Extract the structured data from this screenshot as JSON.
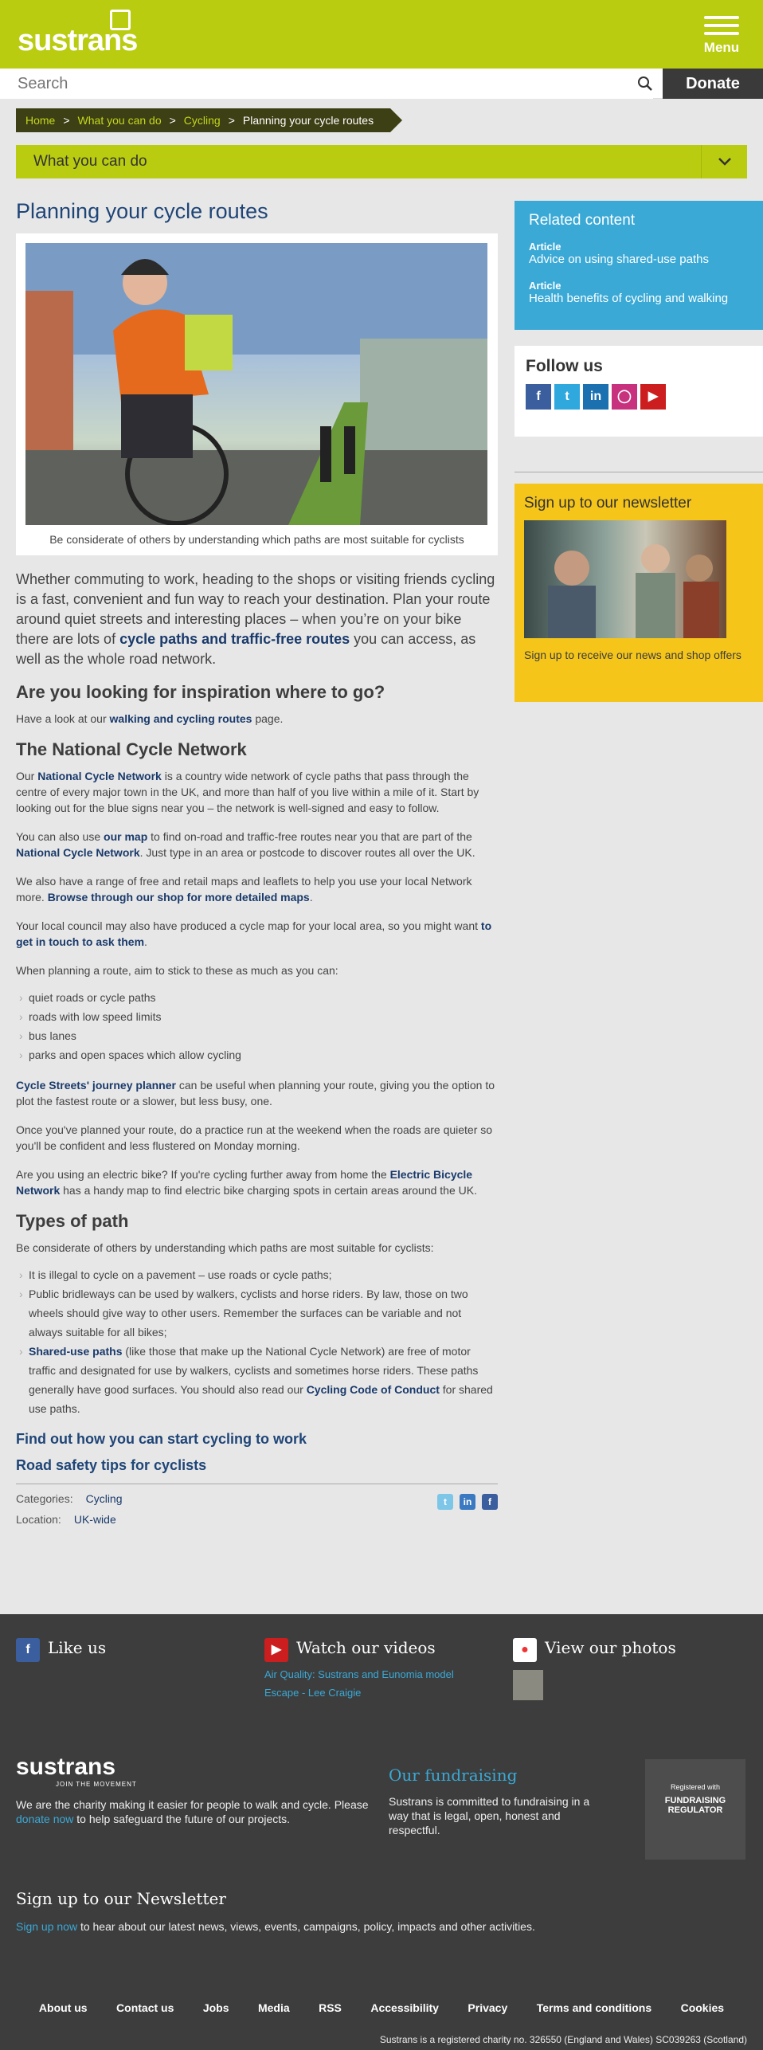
{
  "header": {
    "logo_text": "sustrans",
    "menu_label": "Menu",
    "search_placeholder": "Search",
    "donate_label": "Donate"
  },
  "breadcrumb": [
    "Home",
    "What you can do",
    "Cycling",
    "Planning your cycle routes"
  ],
  "section_nav": {
    "label": "What you can do"
  },
  "article": {
    "title": "Planning your cycle routes",
    "image_caption": "Be considerate of others by understanding which paths are most suitable for cyclists",
    "intro_pre": "Whether commuting to work, heading to the shops or visiting friends cycling is a fast, convenient and fun way to reach your destination. Plan your route around quiet streets and interesting places – when you’re on your bike there are lots of ",
    "intro_link": "cycle paths and traffic-free routes",
    "intro_post": " you can access, as well as the whole road network.",
    "inspiration_heading": "Are you looking for inspiration where to go?",
    "inspiration_pre": "Have a look at our ",
    "inspiration_link": "walking and cycling routes",
    "inspiration_post": " page.",
    "ncn_heading": "The National Cycle Network",
    "p1_pre": "Our ",
    "p1_link": "National Cycle Network",
    "p1_post": " is a country wide network of cycle paths that pass through the centre of every major town in the UK, and more than half of you live within a mile of it. Start by looking out for the blue signs near you – the network is well-signed and easy to follow.",
    "p2_pre": "You can also use ",
    "p2_link1": "our map",
    "p2_mid": " to find on-road and traffic-free routes near you that are part of the ",
    "p2_link2": "National Cycle Network",
    "p2_post": ". Just type in an area or postcode to discover routes all over the UK.",
    "p3_pre": "We also have a range of free and retail maps and leaflets to help you use your local Network more. ",
    "p3_link": "Browse through our shop for more detailed maps",
    "p3_post": ".",
    "p4_pre": "Your local council may also have produced a cycle map for your local area, so you might want ",
    "p4_link": "to get in touch to ask them",
    "p4_post": ".",
    "p5": "When planning a route, aim to stick to these as much as you can:",
    "route_list": [
      "quiet roads or cycle paths",
      "roads with low speed limits",
      "bus lanes",
      "parks and open spaces which allow cycling"
    ],
    "p6_link": "Cycle Streets' journey planner",
    "p6_post": " can be useful when planning your route, giving you the option to plot the fastest route or a slower, but less busy, one.",
    "p7": "Once you've planned your route, do a practice run at the weekend when the roads are quieter so you'll be confident and less flustered on Monday morning.",
    "p8_pre": "Are you using an electric bike? If you're cycling further away from home the ",
    "p8_link": "Electric Bicycle Network",
    "p8_post": " has a handy map to find electric bike charging spots in certain areas around the UK.",
    "types_heading": "Types of path",
    "types_intro": "Be considerate of others by understanding which paths are most suitable for cyclists:",
    "types_1": "It is illegal to cycle on a pavement – use roads or cycle paths;",
    "types_2": "Public bridleways can be used by walkers, cyclists and horse riders. By law, those on two wheels should give way to other users. Remember the surfaces can be variable and not always suitable for all bikes;",
    "types_3_link": "Shared-use paths",
    "types_3_mid": " (like those that make up the National Cycle Network) are free of motor traffic and designated for use by walkers, cyclists and sometimes horse riders. These paths generally have good surfaces. You should also read our ",
    "types_3_link2": "Cycling Code of Conduct",
    "types_3_post": " for shared use paths.",
    "link_work": "Find out how you can start cycling to work",
    "link_safety": "Road safety tips for cyclists",
    "categories_label": "Categories:",
    "categories_value": "Cycling",
    "location_label": "Location:",
    "location_value": "UK-wide"
  },
  "sidebar": {
    "related_title": "Related content",
    "related": [
      {
        "kind": "Article",
        "label": "Advice on using shared-use paths"
      },
      {
        "kind": "Article",
        "label": "Health benefits of cycling and walking"
      }
    ],
    "follow_title": "Follow us",
    "newsletter_title": "Sign up to our newsletter",
    "newsletter_link": "Sign up to receive our news and shop offers"
  },
  "footer": {
    "like_title": "Like us",
    "videos_title": "Watch our videos",
    "videos_links": [
      "Air Quality: Sustrans and Eunomia model",
      "Escape - Lee Craigie"
    ],
    "photos_title": "View our photos",
    "logo_text": "sustrans",
    "logo_tagline": "JOIN THE MOVEMENT",
    "charity_pre": "We are the charity making it easier for people to walk and cycle. Please ",
    "charity_link": "donate now",
    "charity_post": " to help safeguard the future of our projects.",
    "fundraising_title": "Our fundraising",
    "fundraising_text": "Sustrans is committed to fundraising in a way that is legal, open, honest and respectful.",
    "regulator_top": "Registered with",
    "regulator_name": "FUNDRAISING REGULATOR",
    "newsletter_title": "Sign up to our Newsletter",
    "newsletter_link": "Sign up now",
    "newsletter_text": " to hear about our latest news, views, events, campaigns, policy, impacts and other activities.",
    "nav": [
      "About us",
      "Contact us",
      "Jobs",
      "Media",
      "RSS",
      "Accessibility",
      "Privacy",
      "Terms and conditions",
      "Cookies"
    ],
    "legal": "Sustrans is a registered charity no. 326550 (England and Wales) SC039263 (Scotland)"
  },
  "colors": {
    "brand_green": "#b9cc0f",
    "related_blue": "#3aa9d6",
    "newsletter_yellow": "#f5c51a",
    "footer_bg": "#3d3d3d"
  }
}
